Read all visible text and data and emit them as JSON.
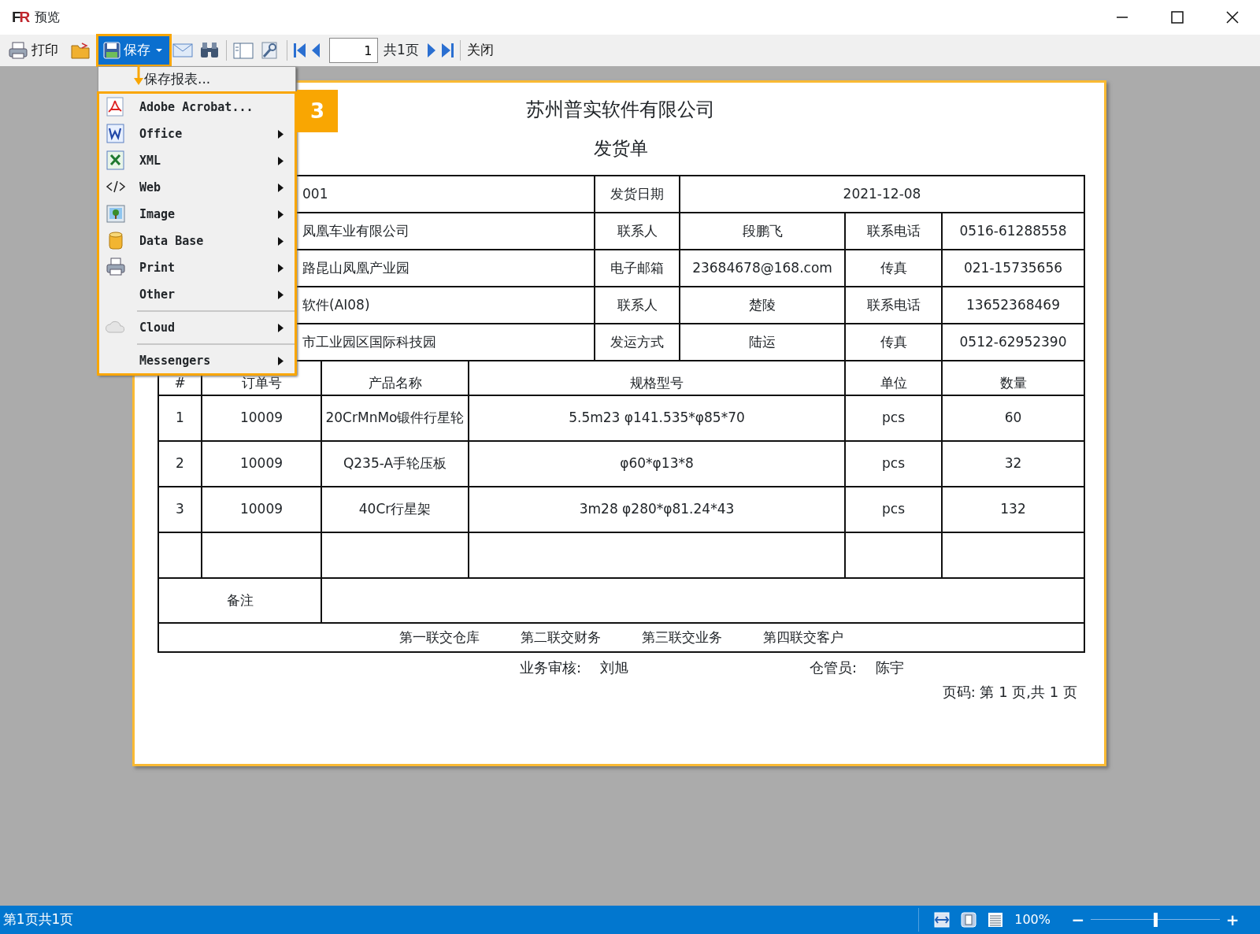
{
  "window": {
    "logo": "FR",
    "title": "预览"
  },
  "toolbar": {
    "print": "打印",
    "save": "保存",
    "page_input": "1",
    "page_total": "共1页",
    "close": "关闭"
  },
  "save_menu": {
    "header": "保存报表...",
    "items": [
      {
        "label": "Adobe Acrobat...",
        "submenu": false,
        "separator_before": false
      },
      {
        "label": "Office",
        "submenu": true,
        "separator_before": false
      },
      {
        "label": "XML",
        "submenu": true,
        "separator_before": false
      },
      {
        "label": "Web",
        "submenu": true,
        "separator_before": false
      },
      {
        "label": "Image",
        "submenu": true,
        "separator_before": false
      },
      {
        "label": "Data Base",
        "submenu": true,
        "separator_before": false
      },
      {
        "label": "Print",
        "submenu": true,
        "separator_before": false
      },
      {
        "label": "Other",
        "submenu": true,
        "separator_before": false
      },
      {
        "label": "Cloud",
        "submenu": true,
        "separator_before": true
      },
      {
        "label": "Messengers",
        "submenu": true,
        "separator_before": true
      }
    ]
  },
  "annotation": {
    "step": "3"
  },
  "report": {
    "company": "苏州普实软件有限公司",
    "title": "发货单",
    "info_rows": [
      [
        "001",
        "发货日期",
        "2021-12-08"
      ],
      [
        "凤凰车业有限公司",
        "联系人",
        "段鹏飞",
        "联系电话",
        "0516-61288558"
      ],
      [
        "路昆山凤凰产业园",
        "电子邮箱",
        "23684678@168.com",
        "传真",
        "021-15735656"
      ],
      [
        "软件(AI08)",
        "联系人",
        "楚陵",
        "联系电话",
        "13652368469"
      ],
      [
        "市工业园区国际科技园",
        "发运方式",
        "陆运",
        "传真",
        "0512-62952390"
      ]
    ],
    "columns": [
      "#",
      "订单号",
      "产品名称",
      "规格型号",
      "单位",
      "数量"
    ],
    "rows": [
      [
        "1",
        "10009",
        "20CrMnMo锻件行星轮",
        "5.5m23 φ141.535*φ85*70",
        "pcs",
        "60"
      ],
      [
        "2",
        "10009",
        "Q235-A手轮压板",
        "φ60*φ13*8",
        "pcs",
        "32"
      ],
      [
        "3",
        "10009",
        "40Cr行星架",
        "3m28 φ280*φ81.24*43",
        "pcs",
        "132"
      ]
    ],
    "remark_label": "备注",
    "copies": [
      "第一联交仓库",
      "第二联交财务",
      "第三联交业务",
      "第四联交客户"
    ],
    "signatures": [
      {
        "label": "业务审核:",
        "name": "刘旭"
      },
      {
        "label": "仓管员:",
        "name": "陈宇"
      }
    ],
    "page_number": "页码: 第 1 页,共 1 页"
  },
  "status_bar": {
    "page": "第1页共1页",
    "zoom": "100%",
    "zoom_out": "−",
    "zoom_in": "+",
    "zoom_slider": {
      "level": 0.5
    }
  }
}
